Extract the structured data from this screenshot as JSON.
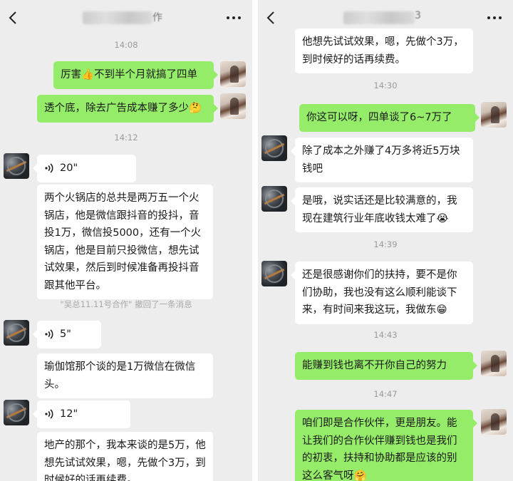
{
  "colors": {
    "chat_bg": "#ededed",
    "sent_bubble": "#95ec69",
    "received_bubble": "#ffffff",
    "timestamp": "#9a9a9a"
  },
  "left_panel": {
    "header": {
      "title_tail": "作",
      "back_icon": "chevron-left-icon",
      "more_icon": "more-icon"
    },
    "timestamps": [
      "14:08",
      "14:12"
    ],
    "messages": [
      {
        "from": "me",
        "text": "厉害👍不到半个月就搞了四单"
      },
      {
        "from": "me",
        "text": "透个底，除去广告成本赚了多少🤔"
      },
      {
        "from": "client",
        "type": "voice",
        "duration": "20\""
      },
      {
        "from": "client",
        "text": "两个火锅店的总共是两万五一个火锅店，他是微信跟抖音的投抖，音投1万，微信投5000，还有一个火锅店，他是目前只投微信，想先试试效果，然后到时候准备再投抖音跟其他平台。"
      },
      {
        "from": "client",
        "type": "voice",
        "duration": "5\""
      },
      {
        "from": "client",
        "text": "瑜伽馆那个谈的是1万微信在微信头。"
      },
      {
        "from": "client",
        "type": "voice",
        "duration": "12\""
      },
      {
        "from": "client",
        "text": "地产的那个，我本来谈的是5万，他想先试试效果，嗯，先做个3万，到时候好的话再续费。"
      }
    ],
    "recall_notice": "\"吴总11.11号合作\" 撤回了一条消息"
  },
  "right_panel": {
    "header": {
      "title_tail": "3",
      "back_icon": "chevron-left-icon",
      "more_icon": "more-icon"
    },
    "timestamps": [
      "14:30",
      "14:39",
      "14:43",
      "14:47"
    ],
    "messages": [
      {
        "from": "client",
        "text": "他想先试试效果，嗯，先做个3万，到时候好的话再续费。"
      },
      {
        "from": "me",
        "text": "你这可以呀，四单谈了6~7万了"
      },
      {
        "from": "client",
        "text": "除了成本之外赚了4万多将近5万块钱吧"
      },
      {
        "from": "client",
        "text": "是哦，说实话还是比较满意的，我现在建筑行业年底收钱太难了😭"
      },
      {
        "from": "client",
        "text": "还是很感谢你们的扶持，要不是你们协助，我也没有这么顺利能谈下来，有时间来我这玩，我做东😁"
      },
      {
        "from": "me",
        "text": "能赚到钱也离不开你自己的努力"
      },
      {
        "from": "me",
        "text": "咱们即是合作伙伴，更是朋友。能让我们的合作伙伴赚到钱也是我们的初衷，扶持和协助都是应该的别这么客气呀🤗"
      }
    ]
  }
}
